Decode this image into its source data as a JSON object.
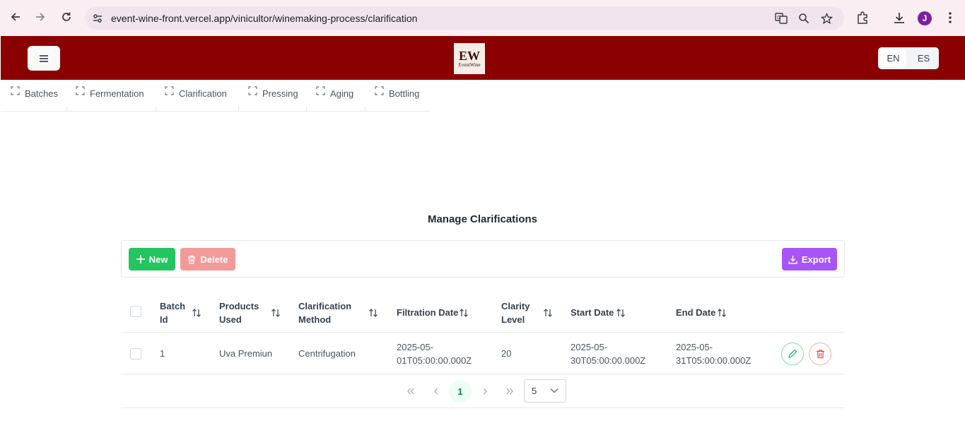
{
  "browser": {
    "url": "event-wine-front.vercel.app/vinicultor/winemaking-process/clarification",
    "profile_initial": "J"
  },
  "header": {
    "logo_main": "EW",
    "logo_sub": "EventWine",
    "lang_en": "EN",
    "lang_es": "ES",
    "brand_color": "#8b0000"
  },
  "tabs": [
    {
      "label": "Batches"
    },
    {
      "label": "Fermentation"
    },
    {
      "label": "Clarification"
    },
    {
      "label": "Pressing"
    },
    {
      "label": "Aging"
    },
    {
      "label": "Bottling"
    }
  ],
  "main": {
    "title": "Manage Clarifications",
    "toolbar": {
      "new_label": "New",
      "delete_label": "Delete",
      "export_label": "Export"
    },
    "table": {
      "columns": [
        {
          "line1": "Batch",
          "line2": "Id"
        },
        {
          "line1": "Products",
          "line2": "Used"
        },
        {
          "line1": "Clarification",
          "line2": "Method"
        },
        {
          "line1": "Filtration Date",
          "line2": ""
        },
        {
          "line1": "Clarity",
          "line2": "Level"
        },
        {
          "line1": "Start Date",
          "line2": ""
        },
        {
          "line1": "End Date",
          "line2": ""
        }
      ],
      "rows": [
        {
          "batch_id": "1",
          "products_used": "Uva Premiun",
          "clarification_method": "Centrifugation",
          "filtration_date_1": "2025-05-",
          "filtration_date_2": "01T05:00:00.000Z",
          "clarity_level": "20",
          "start_date_1": "2025-05-",
          "start_date_2": "30T05:00:00.000Z",
          "end_date_1": "2025-05-",
          "end_date_2": "31T05:00:00.000Z"
        }
      ]
    },
    "paginator": {
      "current_page": "1",
      "rows_per_page": "5"
    }
  }
}
